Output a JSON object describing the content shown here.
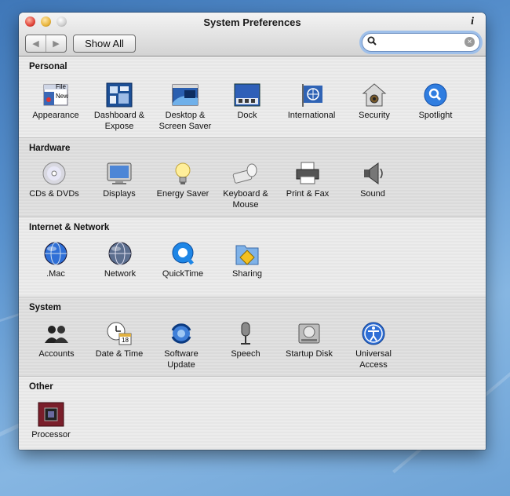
{
  "window": {
    "title": "System Preferences",
    "info_glyph": "i",
    "toolbar": {
      "back_glyph": "◀",
      "forward_glyph": "▶",
      "show_all_label": "Show All",
      "search_value": "",
      "search_placeholder": "",
      "search_glyph": "🔍",
      "clear_glyph": "×"
    }
  },
  "sections": [
    {
      "title": "Personal",
      "items": [
        {
          "label": "Appearance",
          "icon": "appearance-icon"
        },
        {
          "label": "Dashboard &\nExpose",
          "icon": "dashboard-icon"
        },
        {
          "label": "Desktop &\nScreen Saver",
          "icon": "desktop-icon"
        },
        {
          "label": "Dock",
          "icon": "dock-icon"
        },
        {
          "label": "International",
          "icon": "international-icon"
        },
        {
          "label": "Security",
          "icon": "security-icon"
        },
        {
          "label": "Spotlight",
          "icon": "spotlight-icon"
        }
      ]
    },
    {
      "title": "Hardware",
      "items": [
        {
          "label": "CDs & DVDs",
          "icon": "cd-dvd-icon"
        },
        {
          "label": "Displays",
          "icon": "displays-icon"
        },
        {
          "label": "Energy Saver",
          "icon": "energy-saver-icon"
        },
        {
          "label": "Keyboard &\nMouse",
          "icon": "keyboard-mouse-icon"
        },
        {
          "label": "Print & Fax",
          "icon": "printer-icon"
        },
        {
          "label": "Sound",
          "icon": "sound-icon"
        }
      ]
    },
    {
      "title": "Internet & Network",
      "items": [
        {
          "label": ".Mac",
          "icon": "dotmac-icon"
        },
        {
          "label": "Network",
          "icon": "network-icon"
        },
        {
          "label": "QuickTime",
          "icon": "quicktime-icon"
        },
        {
          "label": "Sharing",
          "icon": "sharing-icon"
        }
      ]
    },
    {
      "title": "System",
      "items": [
        {
          "label": "Accounts",
          "icon": "accounts-icon"
        },
        {
          "label": "Date & Time",
          "icon": "date-time-icon"
        },
        {
          "label": "Software\nUpdate",
          "icon": "software-update-icon"
        },
        {
          "label": "Speech",
          "icon": "speech-icon"
        },
        {
          "label": "Startup Disk",
          "icon": "startup-disk-icon"
        },
        {
          "label": "Universal\nAccess",
          "icon": "universal-access-icon"
        }
      ]
    },
    {
      "title": "Other",
      "items": [
        {
          "label": "Processor",
          "icon": "processor-icon"
        }
      ]
    }
  ],
  "icon_texts": {
    "appearance_file": "File",
    "appearance_new": "New",
    "date_day": "18"
  },
  "colors": {
    "accent_blue": "#2f6fd6",
    "window_bg": "#ececec",
    "search_focus": "#9fc0ea"
  }
}
